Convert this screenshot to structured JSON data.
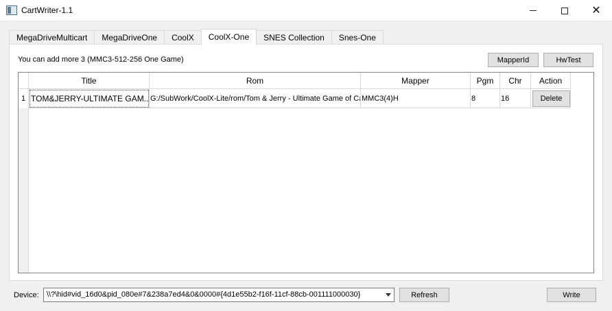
{
  "window": {
    "title": "CartWriter-1.1",
    "minimize_icon": "minimize-icon",
    "maximize_icon": "maximize-icon",
    "close_icon": "close-icon",
    "close_glyph": "✕"
  },
  "tabs": [
    {
      "label": "MegaDriveMulticart",
      "active": false
    },
    {
      "label": "MegaDriveOne",
      "active": false
    },
    {
      "label": "CoolX",
      "active": false
    },
    {
      "label": "CoolX-One",
      "active": true
    },
    {
      "label": "SNES Collection",
      "active": false
    },
    {
      "label": "Snes-One",
      "active": false
    }
  ],
  "panel": {
    "info_text": "You can add more 3 (MMC3-512-256 One Game)",
    "mapper_button": "MapperId",
    "hwtest_button": "HwTest"
  },
  "table": {
    "columns": [
      "Title",
      "Rom",
      "Mapper",
      "Pgm",
      "Chr",
      "Action"
    ],
    "rows": [
      {
        "index": "1",
        "title": "TOM&JERRY-ULTIMATE GAM...",
        "rom": "G:/SubWork/CoolX-Lite/rom/Tom & Jerry - Ultimate Game of Cat",
        "mapper": "MMC3(4)H",
        "pgm": "8",
        "chr": "16",
        "action": "Delete"
      }
    ]
  },
  "footer": {
    "device_label": "Device:",
    "device_value": "\\\\?\\hid#vid_16d0&pid_080e#7&238a7ed4&0&0000#{4d1e55b2-f16f-11cf-88cb-001111000030}",
    "refresh_button": "Refresh",
    "write_button": "Write"
  }
}
